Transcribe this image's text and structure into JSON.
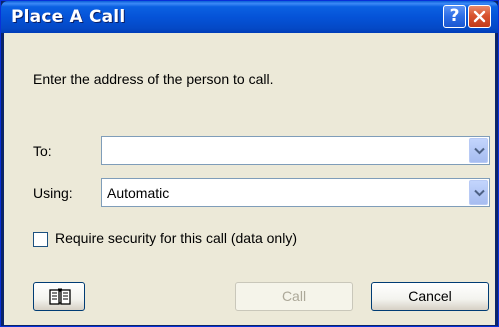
{
  "window": {
    "title": "Place A Call",
    "help_label": "?",
    "close_label": "✕"
  },
  "dialog": {
    "instruction": "Enter the address of the person to call.",
    "to_label": "To:",
    "to_value": "",
    "using_label": "Using:",
    "using_value": "Automatic",
    "security_label": "Require security for this call (data only)",
    "security_checked": false
  },
  "buttons": {
    "address_book_icon": "address-book-icon",
    "call_label": "Call",
    "call_enabled": false,
    "cancel_label": "Cancel"
  },
  "colors": {
    "titlebar": "#0553d8",
    "dialog_bg": "#ece9d8",
    "close_red": "#d8532e",
    "field_border": "#7f9db9",
    "disabled_text": "#aca899"
  }
}
